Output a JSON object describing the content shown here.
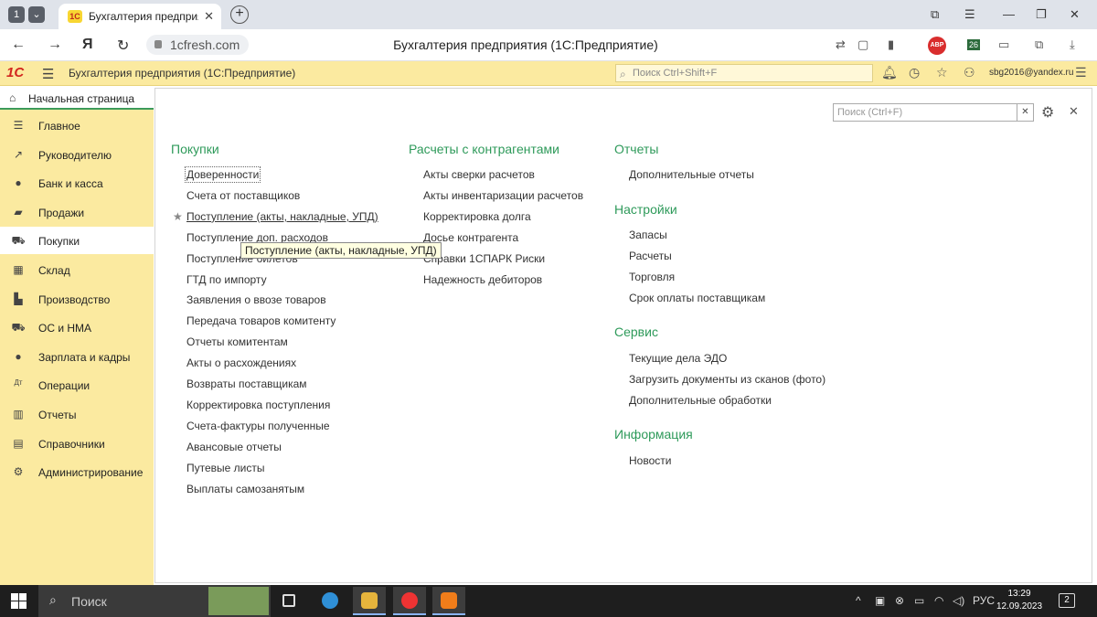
{
  "browser": {
    "tab_counter": "1",
    "tab_title": "Бухгалтерия предприятия",
    "url": "1cfresh.com",
    "page_title": "Бухгалтерия предприятия (1С:Предприятие)",
    "abp_label": "ABP",
    "ext_badge": "26"
  },
  "header": {
    "logo": "1С",
    "app_title": "Бухгалтерия предприятия  (1С:Предприятие)",
    "search_placeholder": "Поиск Ctrl+Shift+F",
    "user": "sbg2016@yandex.ru"
  },
  "sidebar": {
    "home_label": "Начальная страница",
    "items": [
      {
        "label": "Главное",
        "icon": "list-icon"
      },
      {
        "label": "Руководителю",
        "icon": "trend-icon"
      },
      {
        "label": "Банк и касса",
        "icon": "coin-icon"
      },
      {
        "label": "Продажи",
        "icon": "bag-icon"
      },
      {
        "label": "Покупки",
        "icon": "cart-icon"
      },
      {
        "label": "Склад",
        "icon": "warehouse-icon"
      },
      {
        "label": "Производство",
        "icon": "factory-icon"
      },
      {
        "label": "ОС и НМА",
        "icon": "truck-icon"
      },
      {
        "label": "Зарплата и кадры",
        "icon": "person-icon"
      },
      {
        "label": "Операции",
        "icon": "dtkt-icon"
      },
      {
        "label": "Отчеты",
        "icon": "bar-chart-icon"
      },
      {
        "label": "Справочники",
        "icon": "book-icon"
      },
      {
        "label": "Администрирование",
        "icon": "gear-icon"
      }
    ],
    "active_index": 4
  },
  "content": {
    "search_placeholder": "Поиск (Ctrl+F)",
    "tooltip": "Поступление (акты, накладные, УПД)",
    "col1": {
      "title": "Покупки",
      "links": [
        "Доверенности",
        "Счета от поставщиков",
        "Поступление (акты, накладные, УПД)",
        "Поступление доп. расходов",
        "Поступление билетов",
        "ГТД по импорту",
        "Заявления о ввозе товаров",
        "Передача товаров комитенту",
        "Отчеты комитентам",
        "Акты о расхождениях",
        "Возвраты поставщикам",
        "Корректировка поступления",
        "Счета-фактуры полученные",
        "Авансовые отчеты",
        "Путевые листы",
        "Выплаты самозанятым"
      ]
    },
    "col2": {
      "title": "Расчеты с контрагентами",
      "links": [
        "Акты сверки расчетов",
        "Акты инвентаризации расчетов",
        "Корректировка долга",
        "Досье контрагента",
        "Справки 1СПАРК Риски",
        "Надежность дебиторов"
      ]
    },
    "col3": {
      "reports_title": "Отчеты",
      "reports_links": [
        "Дополнительные отчеты"
      ],
      "settings_title": "Настройки",
      "settings_links": [
        "Запасы",
        "Расчеты",
        "Торговля",
        "Срок оплаты поставщикам"
      ],
      "service_title": "Сервис",
      "service_links": [
        "Текущие дела ЭДО",
        "Загрузить документы из сканов (фото)",
        "Дополнительные обработки"
      ],
      "info_title": "Информация",
      "info_links": [
        "Новости"
      ]
    }
  },
  "taskbar": {
    "search_label": "Поиск",
    "lang": "РУС",
    "time": "13:29",
    "date": "12.09.2023",
    "notif_count": "2"
  }
}
